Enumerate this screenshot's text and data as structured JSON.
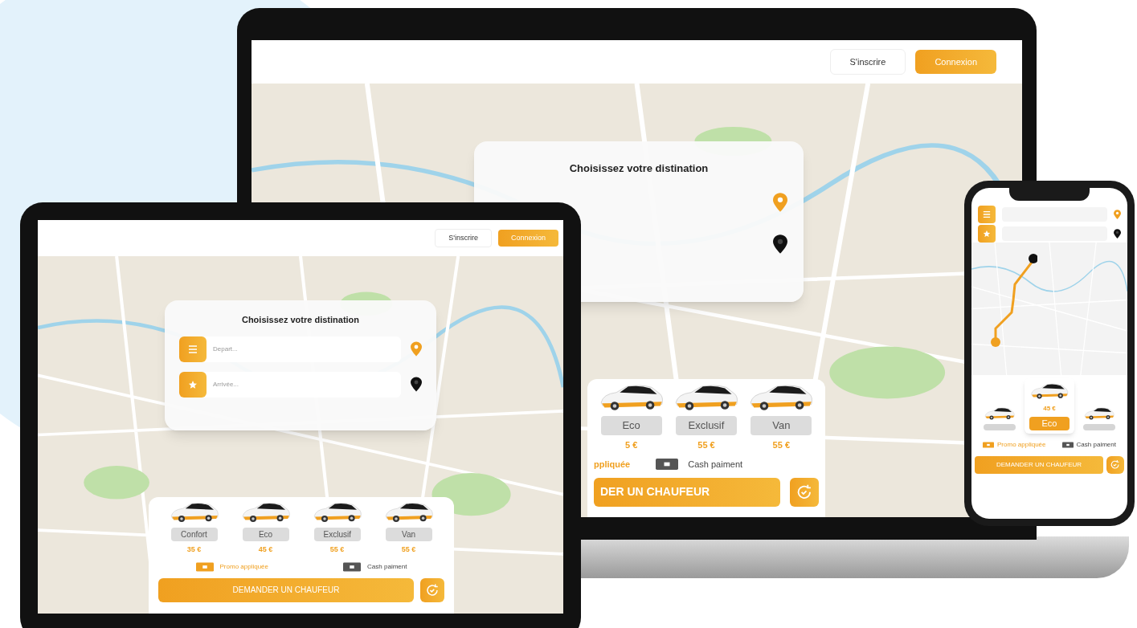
{
  "laptop": {
    "header_buttons": [
      {
        "label": "S'inscrire",
        "kind": "outline"
      },
      {
        "label": "Connexion",
        "kind": "filled"
      }
    ],
    "card": {
      "title": "Choisissez votre distination"
    },
    "vehicles": [
      {
        "label": "Eco",
        "price": "5 €",
        "selected": false
      },
      {
        "label": "Exclusif",
        "price": "55 €",
        "selected": false
      },
      {
        "label": "Van",
        "price": "55 €",
        "selected": false
      }
    ],
    "promo": "ppliquée",
    "payment": "Cash paiment",
    "request_button": "DER UN CHAUFEUR"
  },
  "tablet": {
    "header_buttons": [
      {
        "label": "S'inscrire",
        "kind": "outline"
      },
      {
        "label": "Connexion",
        "kind": "filled"
      }
    ],
    "card": {
      "title": "Choisissez votre distination",
      "fields": [
        {
          "placeholder": "Depart...",
          "kind": "origin"
        },
        {
          "placeholder": "Arrivée...",
          "kind": "destination"
        }
      ]
    },
    "vehicles": [
      {
        "label": "Confort",
        "price": "35 €",
        "selected": false
      },
      {
        "label": "Eco",
        "price": "45 €",
        "selected": false
      },
      {
        "label": "Exclusif",
        "price": "55 €",
        "selected": false
      },
      {
        "label": "Van",
        "price": "55 €",
        "selected": false
      }
    ],
    "promo": "Promo appliquée",
    "payment": "Cash paiment",
    "request_button": "DEMANDER UN CHAUFEUR"
  },
  "phone": {
    "vehicles": [
      {
        "selected": false
      },
      {
        "label": "Eco",
        "price": "45 €",
        "selected": true
      },
      {
        "selected": false
      }
    ],
    "promo": "Promo appliquée",
    "payment": "Cash paiment",
    "request_button": "DEMANDER UN CHAUFEUR"
  }
}
